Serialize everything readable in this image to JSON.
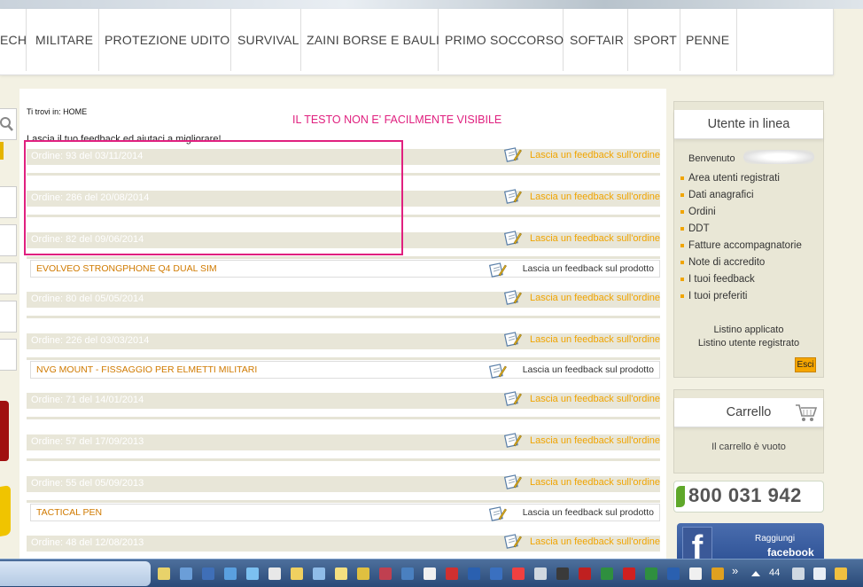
{
  "nav": {
    "items": [
      "ECH",
      "MILITARE",
      "PROTEZIONE UDITO",
      "SURVIVAL",
      "ZAINI BORSE E BAULI",
      "PRIMO SOCCORSO",
      "SOFTAIR",
      "SPORT",
      "PENNE"
    ]
  },
  "main": {
    "breadcrumb": "Ti trovi in: HOME",
    "intro": "Lascia il tuo feedback ed aiutaci a migliorare!",
    "annotation": "IL TESTO NON E' FACILMENTE VISIBILE",
    "order_feedback_label": "Lascia un feedback sull'ordine",
    "product_feedback_label": "Lascia un feedback sul prodotto",
    "orders": [
      {
        "label": "Ordine: 93 del 03/11/2014",
        "product": ""
      },
      {
        "label": "Ordine: 286 del 20/08/2014",
        "product": ""
      },
      {
        "label": "Ordine: 82 del 09/06/2014",
        "product": "EVOLVEO STRONGPHONE Q4 DUAL SIM"
      },
      {
        "label": "Ordine: 80 del 05/05/2014",
        "product": ""
      },
      {
        "label": "Ordine: 226 del 03/03/2014",
        "product": "NVG MOUNT - FISSAGGIO PER ELMETTI MILITARI"
      },
      {
        "label": "Ordine: 71 del 14/01/2014",
        "product": ""
      },
      {
        "label": "Ordine: 57 del 17/09/2013",
        "product": ""
      },
      {
        "label": "Ordine: 55 del 05/09/2013",
        "product": "TACTICAL PEN"
      },
      {
        "label": "Ordine: 48 del 12/08/2013",
        "product": ""
      }
    ]
  },
  "sidebar": {
    "user_box_title": "Utente in linea",
    "welcome": "Benvenuto",
    "menu": [
      "Area utenti registrati",
      "Dati anagrafici",
      "Ordini",
      "DDT",
      "Fatture accompagnatorie",
      "Note di accredito",
      "I tuoi feedback",
      "I tuoi preferiti"
    ],
    "listino_label": "Listino applicato",
    "listino_value": "Listino utente registrato",
    "logout_label": "Esci",
    "cart_title": "Carrello",
    "cart_empty": "Il carrello è vuoto",
    "phone": "800 031 942",
    "facebook_line1": "Raggiungi",
    "facebook_line2": "facebook"
  },
  "taskbar": {
    "chevron": "»",
    "counter": "44"
  },
  "colors": {
    "accent_orange": "#f0a400",
    "annotation_pink": "#e0207f",
    "page_bg": "#f3f1e3",
    "order_row_bg": "#e8e6d8"
  }
}
